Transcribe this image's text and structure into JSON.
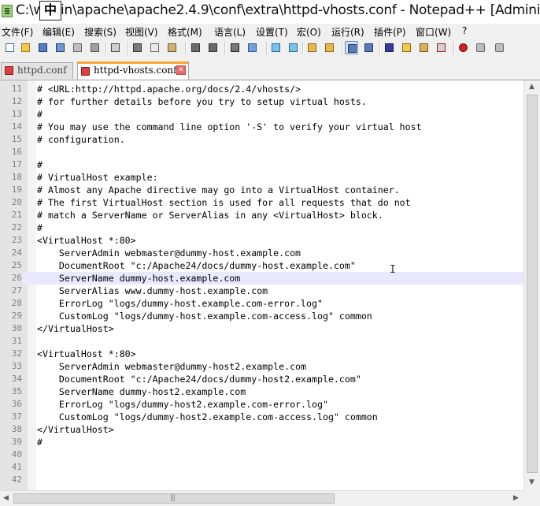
{
  "window": {
    "title": "C:\\w     \\bin\\apache\\apache2.4.9\\conf\\extra\\httpd-vhosts.conf - Notepad++ [Administra",
    "ime_indicator": "中"
  },
  "menu": [
    "文件(F)",
    "编辑(E)",
    "搜索(S)",
    "视图(V)",
    "格式(M)",
    "语言(L)",
    "设置(T)",
    "宏(O)",
    "运行(R)",
    "插件(P)",
    "窗口(W)",
    "?"
  ],
  "tabs": [
    {
      "label": "httpd.conf",
      "active": false
    },
    {
      "label": "httpd-vhosts.conf",
      "active": true
    }
  ],
  "editor": {
    "current_line": 26,
    "lines": [
      {
        "n": "11",
        "text": "# <URL:http://httpd.apache.org/docs/2.4/vhosts/>"
      },
      {
        "n": "12",
        "text": "# for further details before you try to setup virtual hosts."
      },
      {
        "n": "13",
        "text": "#"
      },
      {
        "n": "14",
        "text": "# You may use the command line option '-S' to verify your virtual host"
      },
      {
        "n": "15",
        "text": "# configuration."
      },
      {
        "n": "16",
        "text": ""
      },
      {
        "n": "17",
        "text": "#"
      },
      {
        "n": "18",
        "text": "# VirtualHost example:"
      },
      {
        "n": "19",
        "text": "# Almost any Apache directive may go into a VirtualHost container."
      },
      {
        "n": "20",
        "text": "# The first VirtualHost section is used for all requests that do not"
      },
      {
        "n": "21",
        "text": "# match a ServerName or ServerAlias in any <VirtualHost> block."
      },
      {
        "n": "22",
        "text": "#"
      },
      {
        "n": "23",
        "text": "<VirtualHost *:80>"
      },
      {
        "n": "24",
        "text": "    ServerAdmin webmaster@dummy-host.example.com"
      },
      {
        "n": "25",
        "text": "    DocumentRoot \"c:/Apache24/docs/dummy-host.example.com\""
      },
      {
        "n": "26",
        "text": "    ServerName dummy-host.example.com"
      },
      {
        "n": "27",
        "text": "    ServerAlias www.dummy-host.example.com"
      },
      {
        "n": "28",
        "text": "    ErrorLog \"logs/dummy-host.example.com-error.log\""
      },
      {
        "n": "29",
        "text": "    CustomLog \"logs/dummy-host.example.com-access.log\" common"
      },
      {
        "n": "30",
        "text": "</VirtualHost>"
      },
      {
        "n": "31",
        "text": ""
      },
      {
        "n": "32",
        "text": "<VirtualHost *:80>"
      },
      {
        "n": "33",
        "text": "    ServerAdmin webmaster@dummy-host2.example.com"
      },
      {
        "n": "34",
        "text": "    DocumentRoot \"c:/Apache24/docs/dummy-host2.example.com\""
      },
      {
        "n": "35",
        "text": "    ServerName dummy-host2.example.com"
      },
      {
        "n": "36",
        "text": "    ErrorLog \"logs/dummy-host2.example.com-error.log\""
      },
      {
        "n": "37",
        "text": "    CustomLog \"logs/dummy-host2.example.com-access.log\" common"
      },
      {
        "n": "38",
        "text": "</VirtualHost>"
      },
      {
        "n": "39",
        "text": "#"
      },
      {
        "n": "40",
        "text": ""
      },
      {
        "n": "41",
        "text": ""
      },
      {
        "n": "42",
        "text": ""
      }
    ]
  },
  "toolbar": {
    "buttons": [
      "new-file",
      "open-file",
      "save",
      "save-all",
      "close",
      "close-all",
      "print",
      "cut",
      "copy",
      "paste",
      "undo",
      "redo",
      "find",
      "replace",
      "zoom-in",
      "zoom-out",
      "sync-v",
      "sync-h",
      "word-wrap",
      "show-all-chars",
      "indent-guide",
      "udl",
      "doc-map",
      "function-list",
      "record-macro",
      "stop-macro",
      "play-macro"
    ],
    "colors": {
      "pressed_bg": "#cde0f5",
      "accent_tab": "#f7a734",
      "current_line": "#e8e8ff"
    }
  }
}
